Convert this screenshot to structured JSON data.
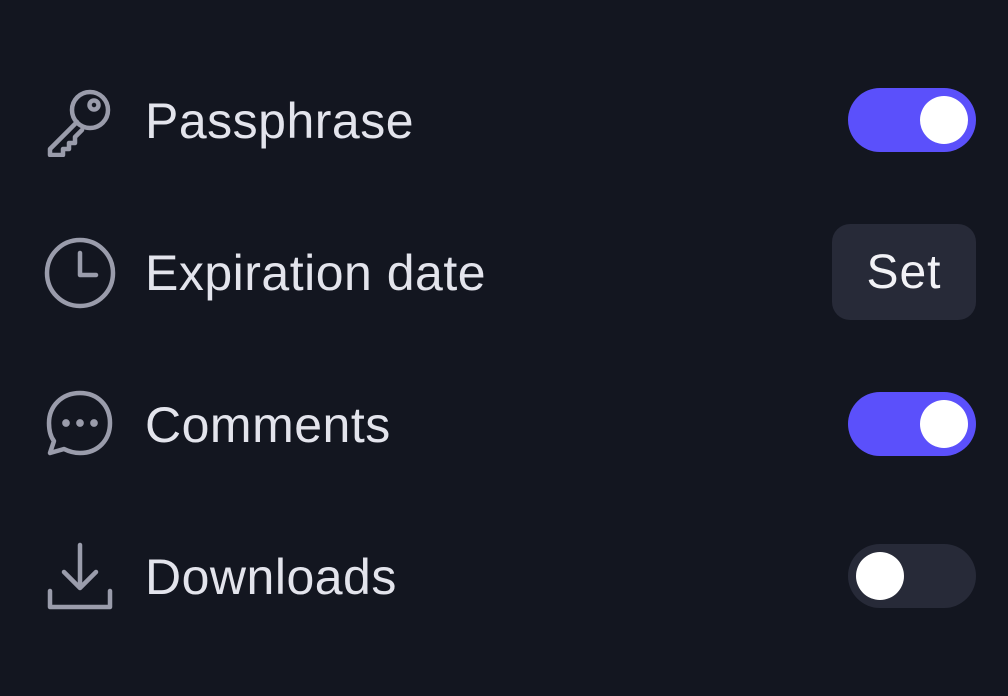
{
  "settings": {
    "items": [
      {
        "label": "Passphrase",
        "icon": "key-icon",
        "control": "toggle",
        "enabled": true
      },
      {
        "label": "Expiration date",
        "icon": "clock-icon",
        "control": "button",
        "button_label": "Set"
      },
      {
        "label": "Comments",
        "icon": "chat-bubble-icon",
        "control": "toggle",
        "enabled": true
      },
      {
        "label": "Downloads",
        "icon": "download-icon",
        "control": "toggle",
        "enabled": false
      }
    ]
  },
  "colors": {
    "background": "#131620",
    "toggle_on": "#5b50fb",
    "toggle_off": "#272a38",
    "icon": "#9a9cab",
    "text": "#e3e4ec"
  }
}
